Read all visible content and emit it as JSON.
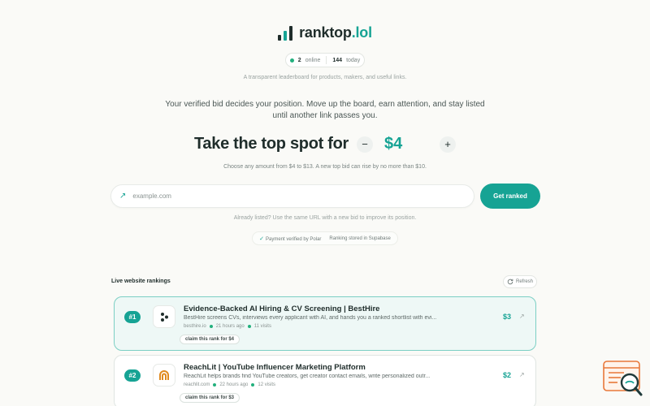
{
  "brand": {
    "name": "ranktop",
    "tld": ".lol"
  },
  "stats": {
    "online_count": "2",
    "online_label": "online",
    "today_count": "144",
    "today_label": "today"
  },
  "tagline": "A transparent leaderboard for products, makers, and useful links.",
  "intro": "Your verified bid decides your position. Move up the board, earn attention, and stay listed until another link passes you.",
  "bid": {
    "title": "Take the top spot for",
    "minus": "−",
    "plus": "+",
    "amount": "$4"
  },
  "bid_rule": "Choose any amount from $4 to $13. A new top bid can rise by no more than $10.",
  "url_input": {
    "placeholder": "example.com",
    "value": ""
  },
  "submit_label": "Get ranked",
  "already_listed": "Already listed? Use the same URL with a new bid to improve its position.",
  "badges": {
    "payment": "Payment verified by Polar",
    "storage": "Ranking stored in Supabase"
  },
  "rankings": {
    "title": "Live website rankings",
    "refresh_label": "Refresh",
    "items": [
      {
        "rank": "#1",
        "title": "Evidence-Backed AI Hiring & CV Screening | BestHire",
        "description": "BestHire screens CVs, interviews every applicant with AI, and hands you a ranked shortlist with evi...",
        "domain": "besthire.io",
        "time": "21 hours ago",
        "visits": "11 visits",
        "claim": "claim this rank for $4",
        "price": "$3"
      },
      {
        "rank": "#2",
        "title": "ReachLit | YouTube Influencer Marketing Platform",
        "description": "ReachLit helps brands find YouTube creators, get creator contact emails, write personalized outr...",
        "domain": "reachlit.com",
        "time": "22 hours ago",
        "visits": "12 visits",
        "claim": "claim this rank for $3",
        "price": "$2"
      }
    ]
  },
  "colors": {
    "accent": "#16a394",
    "ink": "#1f2d2b",
    "background": "#fafaf7",
    "widget_orange": "#e8783a"
  },
  "icons": {
    "logo": "bar-chart-icon",
    "input": "arrow-up-right-icon",
    "refresh": "refresh-icon",
    "check": "check-icon",
    "external": "external-link-icon",
    "widget": "search-chat-icon"
  }
}
